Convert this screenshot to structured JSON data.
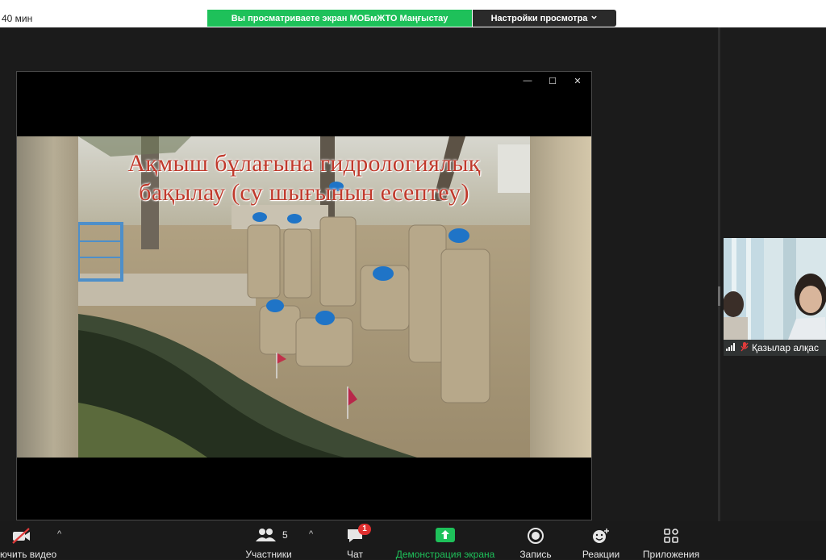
{
  "header": {
    "timer": "40 мин",
    "share_banner": "Вы просматриваете экран МОБмЖТО Маңғыстау",
    "view_options": "Настройки просмотра"
  },
  "slide": {
    "title_line1": "Ақмыш бұлағына гидрологиялық",
    "title_line2": "бақылау (су шығынын есептеу)"
  },
  "participant": {
    "name": "Қазылар алқас"
  },
  "toolbar": {
    "video_label": "ючить видео",
    "participants_label": "Участники",
    "participants_count": "5",
    "chat_label": "Чат",
    "chat_badge": "1",
    "share_label": "Демонстрация экрана",
    "record_label": "Запись",
    "reactions_label": "Реакции",
    "apps_label": "Приложения"
  },
  "colors": {
    "share_banner_bg": "#1ec15a",
    "share_label": "#1ec15a",
    "badge": "#e02f2f",
    "slide_title": "#c0392b"
  },
  "icons": [
    "video-off-icon",
    "participants-icon",
    "chat-icon",
    "share-screen-icon",
    "record-icon",
    "reactions-icon",
    "apps-icon",
    "signal-icon",
    "mic-muted-icon",
    "chevron-down-icon",
    "minimize-icon",
    "maximize-icon",
    "close-icon"
  ]
}
